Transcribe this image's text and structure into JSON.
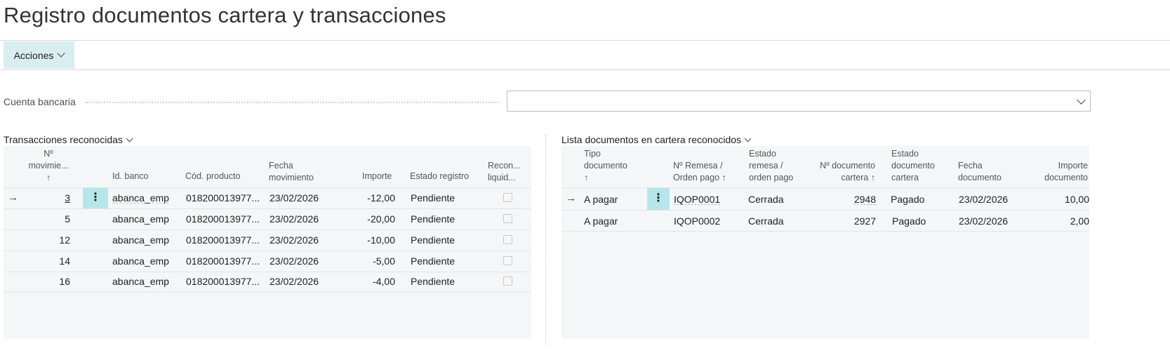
{
  "page": {
    "title": "Registro documentos cartera y transacciones"
  },
  "toolbar": {
    "actions_label": "Acciones"
  },
  "filter": {
    "label": "Cuenta bancaria",
    "value": ""
  },
  "transactions": {
    "caption": "Transacciones reconocidas",
    "headers": {
      "no": [
        "Nº",
        "movimie...",
        "↑"
      ],
      "bank_id": "Id. banco",
      "product": "Cód. producto",
      "date": [
        "Fecha",
        "movimiento"
      ],
      "amount": "Importe",
      "status": "Estado registro",
      "recon": [
        "Recon...",
        "liquid..."
      ]
    },
    "rows": [
      {
        "no": "3",
        "bank_id": "abanca_emp",
        "product": "018200013977...",
        "date": "23/02/2026",
        "amount": "-12,00",
        "status": "Pendiente"
      },
      {
        "no": "5",
        "bank_id": "abanca_emp",
        "product": "018200013977...",
        "date": "23/02/2026",
        "amount": "-20,00",
        "status": "Pendiente"
      },
      {
        "no": "12",
        "bank_id": "abanca_emp",
        "product": "018200013977...",
        "date": "23/02/2026",
        "amount": "-10,00",
        "status": "Pendiente"
      },
      {
        "no": "14",
        "bank_id": "abanca_emp",
        "product": "018200013977...",
        "date": "23/02/2026",
        "amount": "-5,00",
        "status": "Pendiente"
      },
      {
        "no": "16",
        "bank_id": "abanca_emp",
        "product": "018200013977...",
        "date": "23/02/2026",
        "amount": "-4,00",
        "status": "Pendiente"
      }
    ]
  },
  "documents": {
    "caption": "Lista documentos en cartera reconocidos",
    "headers": {
      "type": [
        "Tipo",
        "documento",
        "↑"
      ],
      "remesa": [
        "Nº Remesa /",
        "Orden pago ↑"
      ],
      "remesa_status": [
        "Estado",
        "remesa /",
        "orden pago"
      ],
      "doc_no": [
        "Nº documento",
        "cartera ↑"
      ],
      "doc_status": [
        "Estado",
        "documento",
        "cartera"
      ],
      "date": [
        "Fecha",
        "documento"
      ],
      "amount": [
        "Importe",
        "documento"
      ]
    },
    "rows": [
      {
        "type": "A pagar",
        "remesa": "IQOP0001",
        "remesa_status": "Cerrada",
        "doc_no": "2948",
        "doc_status": "Pagado",
        "date": "23/02/2026",
        "amount": "10,00"
      },
      {
        "type": "A pagar",
        "remesa": "IQOP0002",
        "remesa_status": "Cerrada",
        "doc_no": "2927",
        "doc_status": "Pagado",
        "date": "23/02/2026",
        "amount": "2,00"
      }
    ]
  },
  "icons": {
    "row_selected": "arrow-right-icon",
    "row_menu": "vertical-dots-icon",
    "dropdown": "chevron-down-icon"
  }
}
